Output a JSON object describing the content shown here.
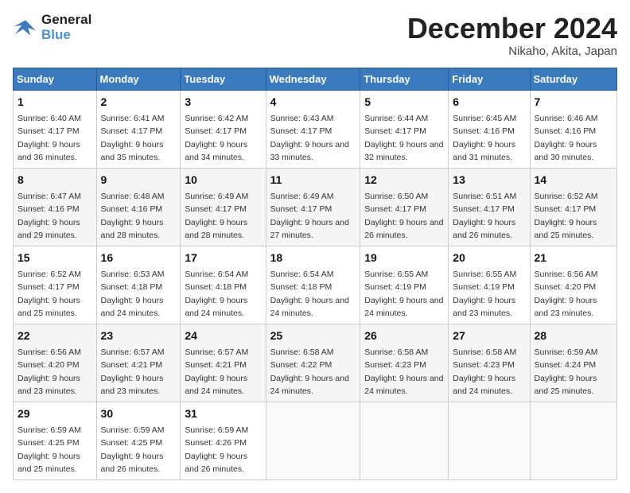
{
  "header": {
    "logo_line1": "General",
    "logo_line2": "Blue",
    "month": "December 2024",
    "location": "Nikaho, Akita, Japan"
  },
  "days_of_week": [
    "Sunday",
    "Monday",
    "Tuesday",
    "Wednesday",
    "Thursday",
    "Friday",
    "Saturday"
  ],
  "weeks": [
    [
      {
        "day": "1",
        "sunrise": "6:40 AM",
        "sunset": "4:17 PM",
        "daylight": "9 hours and 36 minutes."
      },
      {
        "day": "2",
        "sunrise": "6:41 AM",
        "sunset": "4:17 PM",
        "daylight": "9 hours and 35 minutes."
      },
      {
        "day": "3",
        "sunrise": "6:42 AM",
        "sunset": "4:17 PM",
        "daylight": "9 hours and 34 minutes."
      },
      {
        "day": "4",
        "sunrise": "6:43 AM",
        "sunset": "4:17 PM",
        "daylight": "9 hours and 33 minutes."
      },
      {
        "day": "5",
        "sunrise": "6:44 AM",
        "sunset": "4:17 PM",
        "daylight": "9 hours and 32 minutes."
      },
      {
        "day": "6",
        "sunrise": "6:45 AM",
        "sunset": "4:16 PM",
        "daylight": "9 hours and 31 minutes."
      },
      {
        "day": "7",
        "sunrise": "6:46 AM",
        "sunset": "4:16 PM",
        "daylight": "9 hours and 30 minutes."
      }
    ],
    [
      {
        "day": "8",
        "sunrise": "6:47 AM",
        "sunset": "4:16 PM",
        "daylight": "9 hours and 29 minutes."
      },
      {
        "day": "9",
        "sunrise": "6:48 AM",
        "sunset": "4:16 PM",
        "daylight": "9 hours and 28 minutes."
      },
      {
        "day": "10",
        "sunrise": "6:49 AM",
        "sunset": "4:17 PM",
        "daylight": "9 hours and 28 minutes."
      },
      {
        "day": "11",
        "sunrise": "6:49 AM",
        "sunset": "4:17 PM",
        "daylight": "9 hours and 27 minutes."
      },
      {
        "day": "12",
        "sunrise": "6:50 AM",
        "sunset": "4:17 PM",
        "daylight": "9 hours and 26 minutes."
      },
      {
        "day": "13",
        "sunrise": "6:51 AM",
        "sunset": "4:17 PM",
        "daylight": "9 hours and 26 minutes."
      },
      {
        "day": "14",
        "sunrise": "6:52 AM",
        "sunset": "4:17 PM",
        "daylight": "9 hours and 25 minutes."
      }
    ],
    [
      {
        "day": "15",
        "sunrise": "6:52 AM",
        "sunset": "4:17 PM",
        "daylight": "9 hours and 25 minutes."
      },
      {
        "day": "16",
        "sunrise": "6:53 AM",
        "sunset": "4:18 PM",
        "daylight": "9 hours and 24 minutes."
      },
      {
        "day": "17",
        "sunrise": "6:54 AM",
        "sunset": "4:18 PM",
        "daylight": "9 hours and 24 minutes."
      },
      {
        "day": "18",
        "sunrise": "6:54 AM",
        "sunset": "4:18 PM",
        "daylight": "9 hours and 24 minutes."
      },
      {
        "day": "19",
        "sunrise": "6:55 AM",
        "sunset": "4:19 PM",
        "daylight": "9 hours and 24 minutes."
      },
      {
        "day": "20",
        "sunrise": "6:55 AM",
        "sunset": "4:19 PM",
        "daylight": "9 hours and 23 minutes."
      },
      {
        "day": "21",
        "sunrise": "6:56 AM",
        "sunset": "4:20 PM",
        "daylight": "9 hours and 23 minutes."
      }
    ],
    [
      {
        "day": "22",
        "sunrise": "6:56 AM",
        "sunset": "4:20 PM",
        "daylight": "9 hours and 23 minutes."
      },
      {
        "day": "23",
        "sunrise": "6:57 AM",
        "sunset": "4:21 PM",
        "daylight": "9 hours and 23 minutes."
      },
      {
        "day": "24",
        "sunrise": "6:57 AM",
        "sunset": "4:21 PM",
        "daylight": "9 hours and 24 minutes."
      },
      {
        "day": "25",
        "sunrise": "6:58 AM",
        "sunset": "4:22 PM",
        "daylight": "9 hours and 24 minutes."
      },
      {
        "day": "26",
        "sunrise": "6:58 AM",
        "sunset": "4:23 PM",
        "daylight": "9 hours and 24 minutes."
      },
      {
        "day": "27",
        "sunrise": "6:58 AM",
        "sunset": "4:23 PM",
        "daylight": "9 hours and 24 minutes."
      },
      {
        "day": "28",
        "sunrise": "6:59 AM",
        "sunset": "4:24 PM",
        "daylight": "9 hours and 25 minutes."
      }
    ],
    [
      {
        "day": "29",
        "sunrise": "6:59 AM",
        "sunset": "4:25 PM",
        "daylight": "9 hours and 25 minutes."
      },
      {
        "day": "30",
        "sunrise": "6:59 AM",
        "sunset": "4:25 PM",
        "daylight": "9 hours and 26 minutes."
      },
      {
        "day": "31",
        "sunrise": "6:59 AM",
        "sunset": "4:26 PM",
        "daylight": "9 hours and 26 minutes."
      },
      null,
      null,
      null,
      null
    ]
  ]
}
